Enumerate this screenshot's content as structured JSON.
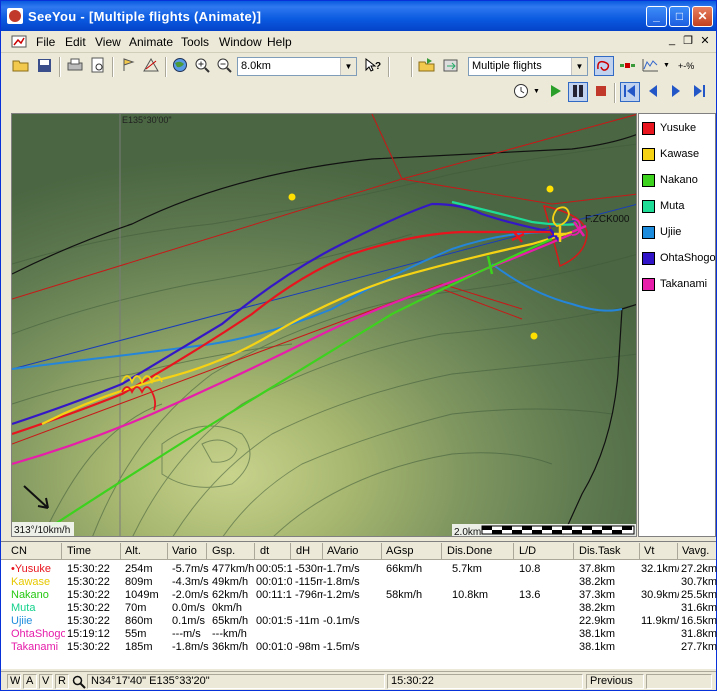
{
  "window": {
    "title": "SeeYou - [Multiple flights (Animate)]",
    "buttons": {
      "minimize": "_",
      "maximize": "□",
      "close": "✕"
    }
  },
  "menu": {
    "items": [
      {
        "label": "File"
      },
      {
        "label": "Edit"
      },
      {
        "label": "View"
      },
      {
        "label": "Animate"
      },
      {
        "label": "Tools"
      },
      {
        "label": "Window"
      },
      {
        "label": "Help"
      }
    ],
    "mdi": {
      "minimize": "_",
      "restore": "❐",
      "close": "✕"
    }
  },
  "toolbar": {
    "distance_value": "8.0km",
    "view_value": "Multiple flights"
  },
  "map": {
    "coord_label": "E135°30'00\"",
    "airfield_label": "F.ZCK000",
    "wind_label": "313°/10km/h",
    "scale_label": "2.0km"
  },
  "legend": [
    {
      "name": "Yusuke",
      "color": "#e8141e"
    },
    {
      "name": "Kawase",
      "color": "#f5d214"
    },
    {
      "name": "Nakano",
      "color": "#3cd21e"
    },
    {
      "name": "Muta",
      "color": "#1edc96"
    },
    {
      "name": "Ujiie",
      "color": "#1e8cdc"
    },
    {
      "name": "OhtaShogo",
      "color": "#3214c8"
    },
    {
      "name": "Takanami",
      "color": "#e61eaa"
    }
  ],
  "table": {
    "headers": [
      "CN",
      "Time",
      "Alt.",
      "Vario",
      "Gsp.",
      "dt",
      "dH",
      "AVario",
      "AGsp",
      "Dis.Done",
      "L/D",
      "Dis.Task",
      "Vt",
      "Vavg."
    ],
    "rows": [
      {
        "color": "#e8141e",
        "cells": [
          "•Yusuke",
          "15:30:22",
          "254m",
          "-5.7m/s",
          "477km/h",
          "00:05:1",
          "-530m",
          "-1.7m/s",
          "66km/h",
          "5.7km",
          "10.8",
          "37.8km",
          "32.1km/",
          "27.2km"
        ]
      },
      {
        "color": "#e6c800",
        "cells": [
          "Kawase",
          "15:30:22",
          "809m",
          "-4.3m/s",
          "49km/h",
          "00:01:0",
          "-115m",
          "-1.8m/s",
          "",
          "",
          "",
          "38.2km",
          "",
          "30.7km"
        ]
      },
      {
        "color": "#28c814",
        "cells": [
          "Nakano",
          "15:30:22",
          "1049m",
          "-2.0m/s",
          "62km/h",
          "00:11:1",
          "-796m",
          "-1.2m/s",
          "58km/h",
          "10.8km",
          "13.6",
          "37.3km",
          "30.9km/",
          "25.5km"
        ]
      },
      {
        "color": "#14d28c",
        "cells": [
          "Muta",
          "15:30:22",
          "70m",
          "0.0m/s",
          "0km/h",
          "",
          "",
          "",
          "",
          "",
          "",
          "38.2km",
          "",
          "31.6km"
        ]
      },
      {
        "color": "#1e8cdc",
        "cells": [
          "Ujiie",
          "15:30:22",
          "860m",
          "0.1m/s",
          "65km/h",
          "00:01:5",
          "-11m",
          "-0.1m/s",
          "",
          "",
          "",
          "22.9km",
          "11.9km/",
          "16.5km"
        ]
      },
      {
        "color": "#e61eaa",
        "cells": [
          "OhtaShogo",
          "15:19:12",
          "55m",
          "---m/s",
          "---km/h",
          "",
          "",
          "",
          "",
          "",
          "",
          "38.1km",
          "",
          "31.8km"
        ]
      },
      {
        "color": "#e61eaa",
        "cells": [
          "Takanami",
          "15:30:22",
          "185m",
          "-1.8m/s",
          "36km/h",
          "00:01:0",
          "-98m",
          "-1.5m/s",
          "",
          "",
          "",
          "38.1km",
          "",
          "27.7km"
        ]
      }
    ]
  },
  "status": {
    "tabs": [
      "W",
      "A",
      "V",
      "R"
    ],
    "coords": "N34°17'40\"  E135°33'20\"",
    "time": "15:30:22",
    "previous": "Previous"
  }
}
